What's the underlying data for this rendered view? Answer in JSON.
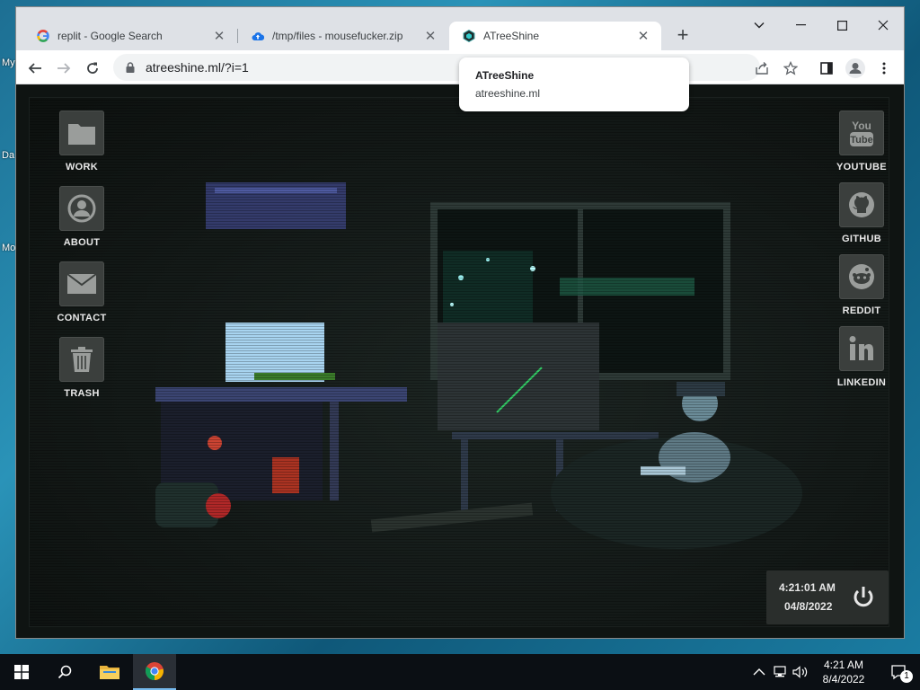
{
  "desktop": {
    "fragments": [
      "My",
      "Da",
      "Mo"
    ]
  },
  "browser": {
    "tabs": [
      {
        "title": "replit - Google Search",
        "icon": "google-icon",
        "active": false
      },
      {
        "title": "/tmp/files - mousefucker.zip",
        "icon": "cloud-upload-icon",
        "active": false
      },
      {
        "title": "ATreeShine",
        "icon": "atreeshine-logo-icon",
        "active": true
      }
    ],
    "close_glyph": "✕",
    "new_tab_glyph": "+",
    "url": "atreeshine.ml/?i=1",
    "hovercard": {
      "title": "ATreeShine",
      "url": "atreeshine.ml"
    }
  },
  "site": {
    "left_icons": [
      {
        "label": "WORK",
        "icon": "folder-icon"
      },
      {
        "label": "ABOUT",
        "icon": "user-icon"
      },
      {
        "label": "CONTACT",
        "icon": "mail-icon"
      },
      {
        "label": "TRASH",
        "icon": "trash-icon"
      }
    ],
    "right_icons": [
      {
        "label": "YOUTUBE",
        "icon": "youtube-icon"
      },
      {
        "label": "GITHUB",
        "icon": "github-icon"
      },
      {
        "label": "REDDIT",
        "icon": "reddit-icon"
      },
      {
        "label": "LINKEDIN",
        "icon": "linkedin-icon"
      }
    ],
    "clock": {
      "time": "4:21:01 AM",
      "date": "04/8/2022"
    }
  },
  "taskbar": {
    "time": "4:21 AM",
    "date": "8/4/2022",
    "notifications": "1"
  }
}
